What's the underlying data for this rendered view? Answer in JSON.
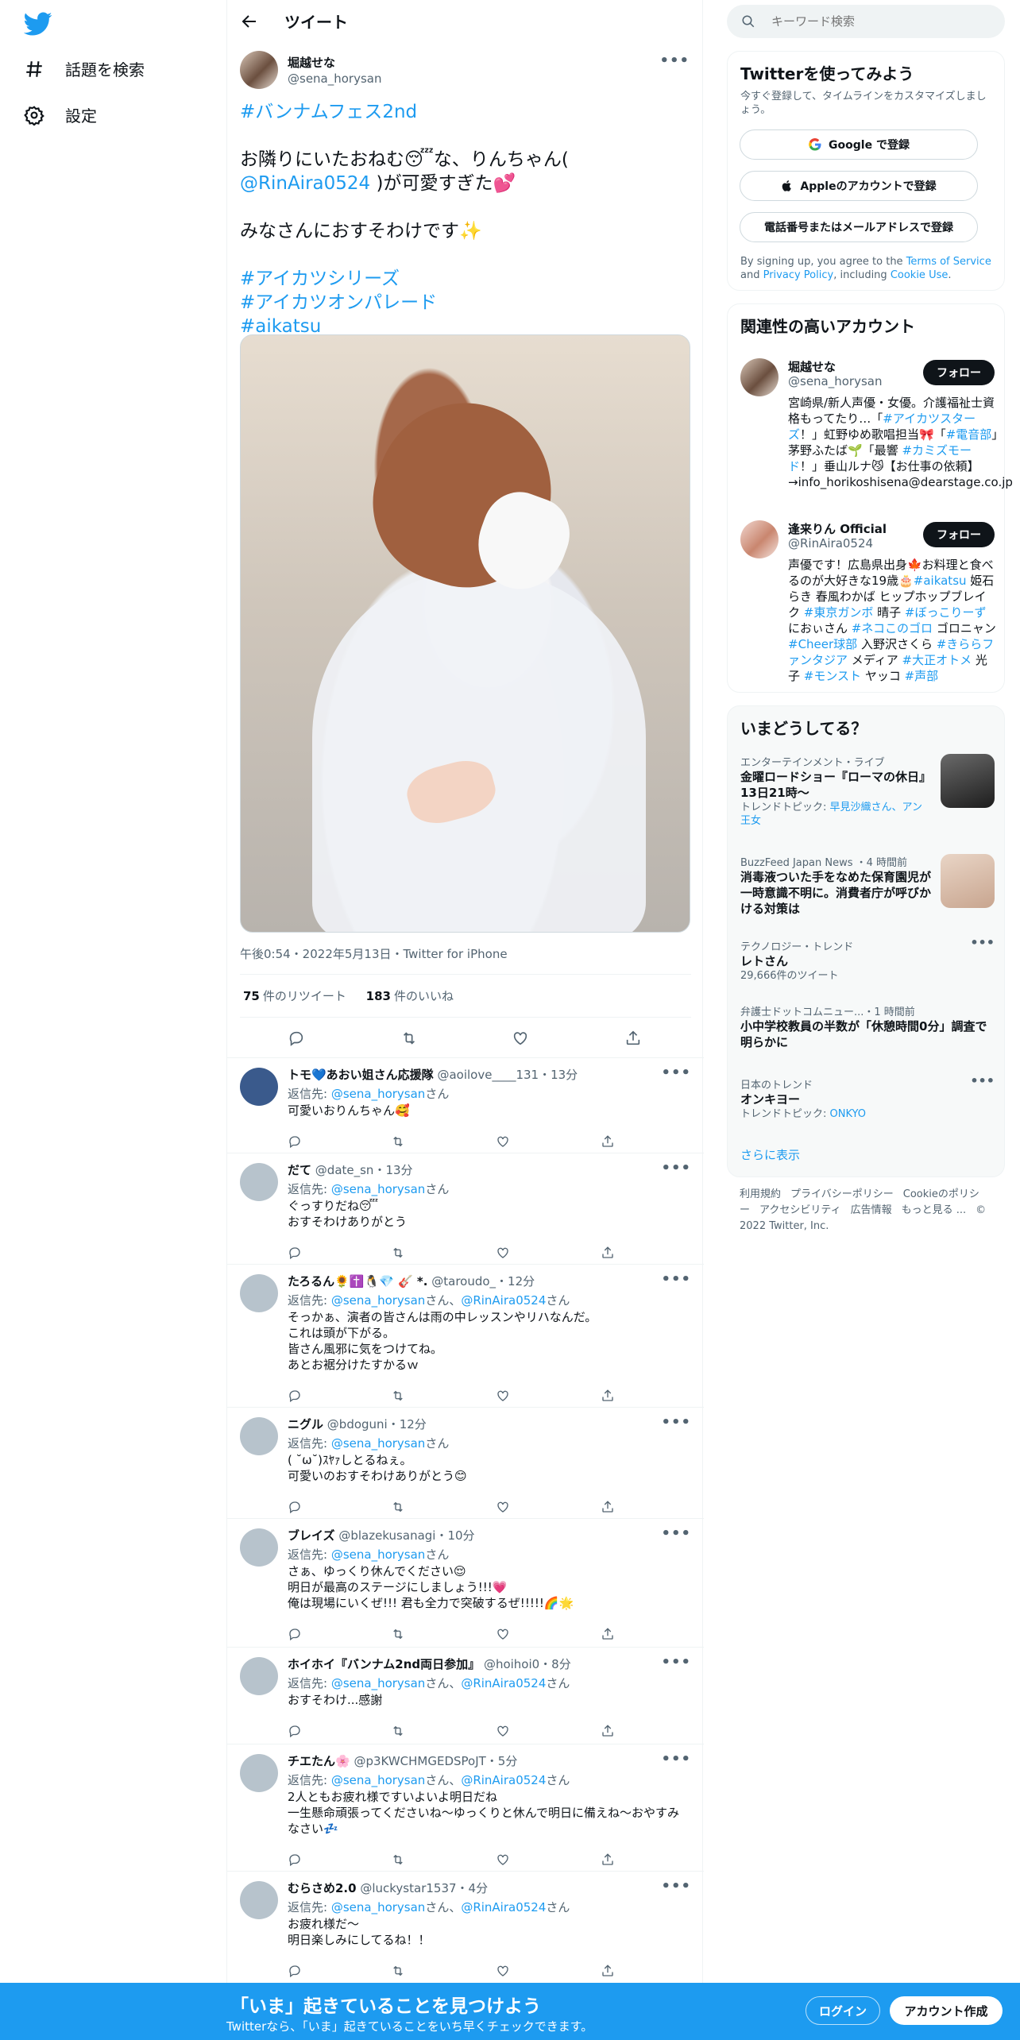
{
  "nav": {
    "explore_label": "話題を検索",
    "settings_label": "設定"
  },
  "header": {
    "title": "ツイート"
  },
  "tweet": {
    "author_name": "堀越せな",
    "author_handle": "@sena_horysan",
    "lines": [
      {
        "parts": [
          {
            "t": "#バンナムフェス2nd",
            "link": true
          }
        ]
      },
      {
        "parts": [
          {
            "t": "",
            "link": false
          }
        ]
      },
      {
        "parts": [
          {
            "t": "お隣りにいたおねむ😴な、りんちゃん(",
            "link": false
          }
        ]
      },
      {
        "parts": [
          {
            "t": "@RinAira0524",
            "link": true
          },
          {
            "t": " )が可愛すぎた💕",
            "link": false
          }
        ]
      },
      {
        "parts": [
          {
            "t": "",
            "link": false
          }
        ]
      },
      {
        "parts": [
          {
            "t": "みなさんにおすそわけです✨",
            "link": false
          }
        ]
      },
      {
        "parts": [
          {
            "t": "",
            "link": false
          }
        ]
      },
      {
        "parts": [
          {
            "t": "#アイカツシリーズ",
            "link": true
          }
        ]
      },
      {
        "parts": [
          {
            "t": "#アイカツオンパレード",
            "link": true
          }
        ]
      },
      {
        "parts": [
          {
            "t": "#aikatsu",
            "link": true
          }
        ]
      }
    ],
    "timestamp": "午後0:54・2022年5月13日・Twitter for iPhone",
    "retweets_count": "75",
    "retweets_label": "件のリツイート",
    "likes_count": "183",
    "likes_label": "件のいいね"
  },
  "replies": [
    {
      "name": "トモ💙あおい姐さん応援隊",
      "handle": "@aoilove____131・13分",
      "reply_prefix": "返信先: ",
      "reply_to": [
        {
          "t": "@sena_horysan",
          "link": true
        },
        {
          "t": "さん",
          "link": false
        }
      ],
      "lines": [
        "可愛いおりんちゃん🥰"
      ],
      "avatar": "#3a5a8c"
    },
    {
      "name": "だて",
      "handle": "@date_sn・13分",
      "reply_prefix": "返信先: ",
      "reply_to": [
        {
          "t": "@sena_horysan",
          "link": true
        },
        {
          "t": "さん",
          "link": false
        }
      ],
      "lines": [
        "ぐっすりだね😴",
        "おすそわけありがとう"
      ],
      "avatar": ""
    },
    {
      "name": "たろるん🌻✝️🐧💎 🎸 *.",
      "handle": "@taroudo_・12分",
      "reply_prefix": "返信先: ",
      "reply_to": [
        {
          "t": "@sena_horysan",
          "link": true
        },
        {
          "t": "さん、",
          "link": false
        },
        {
          "t": "@RinAira0524",
          "link": true
        },
        {
          "t": "さん",
          "link": false
        }
      ],
      "lines": [
        "そっかぁ、演者の皆さんは雨の中レッスンやリハなんだ。",
        "これは頭が下がる。",
        "皆さん風邪に気をつけてね。",
        "あとお裾分けたすかるｗ"
      ],
      "avatar": ""
    },
    {
      "name": "ニグル",
      "handle": "@bdoguni・12分",
      "reply_prefix": "返信先: ",
      "reply_to": [
        {
          "t": "@sena_horysan",
          "link": true
        },
        {
          "t": "さん",
          "link": false
        }
      ],
      "lines": [
        "( ˘ω˘)ｽﾔｧしとるねぇ。",
        "可愛いのおすそわけありがとう😊"
      ],
      "avatar": ""
    },
    {
      "name": "ブレイズ",
      "handle": "@blazekusanagi・10分",
      "reply_prefix": "返信先: ",
      "reply_to": [
        {
          "t": "@sena_horysan",
          "link": true
        },
        {
          "t": "さん",
          "link": false
        }
      ],
      "lines": [
        "さぁ、ゆっくり休んでください😌",
        "明日が最高のステージにしましょう!!!💗",
        "俺は現場にいくぜ!!! 君も全力で突破するぜ!!!!!🌈🌟"
      ],
      "avatar": ""
    },
    {
      "name": "ホイホイ『バンナム2nd両日参加』",
      "handle": "@hoihoi0・8分",
      "reply_prefix": "返信先: ",
      "reply_to": [
        {
          "t": "@sena_horysan",
          "link": true
        },
        {
          "t": "さん、",
          "link": false
        },
        {
          "t": "@RinAira0524",
          "link": true
        },
        {
          "t": "さん",
          "link": false
        }
      ],
      "lines": [
        "おすそわけ...感謝"
      ],
      "avatar": ""
    },
    {
      "name": "チエたん🌸",
      "handle": "@p3KWCHMGEDSPoJT・5分",
      "reply_prefix": "返信先: ",
      "reply_to": [
        {
          "t": "@sena_horysan",
          "link": true
        },
        {
          "t": "さん、",
          "link": false
        },
        {
          "t": "@RinAira0524",
          "link": true
        },
        {
          "t": "さん",
          "link": false
        }
      ],
      "lines": [
        "2人ともお疲れ様ですいよいよ明日だね",
        "一生懸命頑張ってくださいね〜ゆっくりと休んで明日に備えね〜おやすみ",
        "なさい💤"
      ],
      "avatar": ""
    },
    {
      "name": "むらさめ2.0",
      "handle": "@luckystar1537・4分",
      "reply_prefix": "返信先: ",
      "reply_to": [
        {
          "t": "@sena_horysan",
          "link": true
        },
        {
          "t": "さん、",
          "link": false
        },
        {
          "t": "@RinAira0524",
          "link": true
        },
        {
          "t": "さん",
          "link": false
        }
      ],
      "lines": [
        "お疲れ様だ～",
        "明日楽しみにしてるね！！"
      ],
      "avatar": ""
    }
  ],
  "search": {
    "placeholder": "キーワード検索"
  },
  "signup": {
    "title": "Twitterを使ってみよう",
    "subtitle": "今すぐ登録して、タイムラインをカスタマイズしましょう。",
    "google_label": "Google で登録",
    "apple_label": "Appleのアカウントで登録",
    "phone_label": "電話番号またはメールアドレスで登録",
    "terms_parts": [
      {
        "t": "By signing up, you agree to the ",
        "link": false
      },
      {
        "t": "Terms of Service",
        "link": true
      },
      {
        "t": " and ",
        "link": false
      },
      {
        "t": "Privacy Policy",
        "link": true
      },
      {
        "t": ", including ",
        "link": false
      },
      {
        "t": "Cookie Use",
        "link": true
      },
      {
        "t": ".",
        "link": false
      }
    ]
  },
  "related": {
    "title": "関連性の高いアカウント",
    "accounts": [
      {
        "name": "堀越せな",
        "handle": "@sena_horysan",
        "follow_label": "フォロー",
        "bio": [
          {
            "t": "宮崎県/新人声優・女優。介護福祉士資格もってたり…「",
            "link": false
          },
          {
            "t": "#アイカツスターズ",
            "link": true
          },
          {
            "t": "！」虹野ゆめ歌唱担当🎀「",
            "link": false
          },
          {
            "t": "#電音部",
            "link": true
          },
          {
            "t": "」茅野ふたば🌱「最響 ",
            "link": false
          },
          {
            "t": "#カミズモード",
            "link": true
          },
          {
            "t": "！」垂山ルナ😼【お仕事の依頼】→info_horikoshisena@dearstage.co.jp",
            "link": false
          }
        ]
      },
      {
        "name": "逢来りん Official",
        "handle": "@RinAira0524",
        "follow_label": "フォロー",
        "bio": [
          {
            "t": "声優です！広島県出身🍁お料理と食べるのが大好きな19歳🎂",
            "link": false
          },
          {
            "t": "#aikatsu",
            "link": true
          },
          {
            "t": " 姫石らき 春風わかば ヒップホップブレイク ",
            "link": false
          },
          {
            "t": "#東京ガンボ",
            "link": true
          },
          {
            "t": " 晴子 ",
            "link": false
          },
          {
            "t": "#ぼっこりーず",
            "link": true
          },
          {
            "t": " におぃさん ",
            "link": false
          },
          {
            "t": "#ネコこのゴロ",
            "link": true
          },
          {
            "t": " ゴロニャン ",
            "link": false
          },
          {
            "t": "#Cheer球部",
            "link": true
          },
          {
            "t": " 入野沢さくら ",
            "link": false
          },
          {
            "t": "#きららファンタジア",
            "link": true
          },
          {
            "t": " メディア ",
            "link": false
          },
          {
            "t": "#大正オトメ",
            "link": true
          },
          {
            "t": " 光子 ",
            "link": false
          },
          {
            "t": "#モンスト",
            "link": true
          },
          {
            "t": " ヤッコ ",
            "link": false
          },
          {
            "t": "#声部",
            "link": true
          }
        ]
      }
    ]
  },
  "trends": {
    "title": "いまどうしてる？",
    "items": [
      {
        "category": "エンターテインメント・ライブ",
        "title": "金曜ロードショー『ローマの休日』13日21時〜",
        "sub_prefix": "トレンドトピック: ",
        "sub": "早見沙織さん、アン王女"
      },
      {
        "category": "BuzzFeed Japan News ・4 時間前",
        "title": "消毒液ついた手をなめた保育園児が一時意識不明に。消費者庁が呼びかける対策は",
        "sub_prefix": "",
        "sub": ""
      },
      {
        "category": "テクノロジー・トレンド",
        "title": "レトさん",
        "sub_prefix": "",
        "sub": "29,666件のツイート"
      },
      {
        "category": "弁護士ドットコムニュー...・1 時間前",
        "title": "小中学校教員の半数が「休憩時間0分」調査で明らかに",
        "sub_prefix": "",
        "sub": ""
      },
      {
        "category": "日本のトレンド",
        "title": "オンキヨー",
        "sub_prefix": "トレンドトピック: ",
        "sub": "ONKYO"
      }
    ],
    "show_more": "さらに表示"
  },
  "footer": {
    "links": [
      "利用規約",
      "プライバシーポリシー",
      "Cookieのポリシー",
      "アクセシビリティ",
      "広告情報",
      "もっと見る ...",
      "© 2022 Twitter, Inc."
    ]
  },
  "bottom_bar": {
    "title": "「いま」起きていることを見つけよう",
    "subtitle": "Twitterなら、「いま」起きていることをいち早くチェックできます。",
    "login_label": "ログイン",
    "signup_label": "アカウント作成"
  },
  "colors": {
    "accent": "#1d9bf0",
    "text": "#0f1419",
    "muted": "#536471"
  }
}
